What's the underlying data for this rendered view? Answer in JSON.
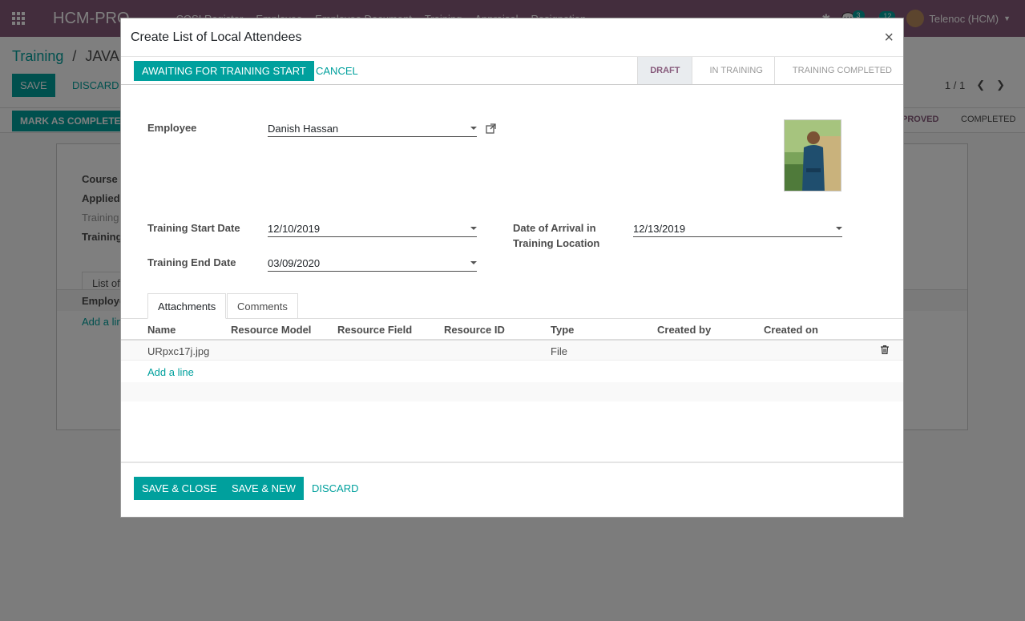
{
  "app": {
    "brand": "HCM-PRO",
    "menu": [
      "COSI Register",
      "Employee",
      "Employee Document",
      "Training",
      "Appraisal",
      "Resignation"
    ],
    "chat_count": "3",
    "activity_count": "12",
    "user_name": "Telenoc (HCM)"
  },
  "background": {
    "breadcrumb_parent": "Training",
    "breadcrumb_sep": "/",
    "breadcrumb_current": "JAVA F",
    "save_label": "SAVE",
    "discard_label": "DISCARD",
    "pager": "1 / 1",
    "mark_label": "MARK AS COMPLETE",
    "stage_approved": "PROVED",
    "stage_completed": "COMPLETED",
    "labels": [
      "Course N",
      "Applied",
      "Training",
      "Training"
    ],
    "tab_label": "List of",
    "col_label": "Employe",
    "add_line": "Add a lin"
  },
  "modal": {
    "title": "Create List of Local Attendees",
    "close_symbol": "×",
    "status_buttons": {
      "await": "AWAITING FOR TRAINING START",
      "cancel": "CANCEL"
    },
    "stages": [
      {
        "label": "DRAFT",
        "active": true
      },
      {
        "label": "IN TRAINING",
        "active": false
      },
      {
        "label": "TRAINING COMPLETED",
        "active": false
      }
    ],
    "fields": {
      "employee_label": "Employee",
      "employee_value": "Danish Hassan",
      "start_label": "Training Start Date",
      "start_value": "12/10/2019",
      "end_label": "Training End Date",
      "end_value": "03/09/2020",
      "arrival_label_1": "Date of Arrival in",
      "arrival_label_2": "Training Location",
      "arrival_value": "12/13/2019"
    },
    "tabs": [
      "Attachments",
      "Comments"
    ],
    "table": {
      "headers": [
        "Name",
        "Resource Model",
        "Resource Field",
        "Resource ID",
        "Type",
        "Created by",
        "Created on"
      ],
      "rows": [
        {
          "name": "URpxc17j.jpg",
          "model": "",
          "field": "",
          "id": "",
          "type": "File",
          "created_by": "",
          "created_on": ""
        }
      ],
      "add_line": "Add a line"
    },
    "footer": {
      "save_close": "SAVE & CLOSE",
      "save_new": "SAVE & NEW",
      "discard": "DISCARD"
    }
  },
  "colors": {
    "brand": "#875a7b",
    "accent": "#00a09d"
  }
}
